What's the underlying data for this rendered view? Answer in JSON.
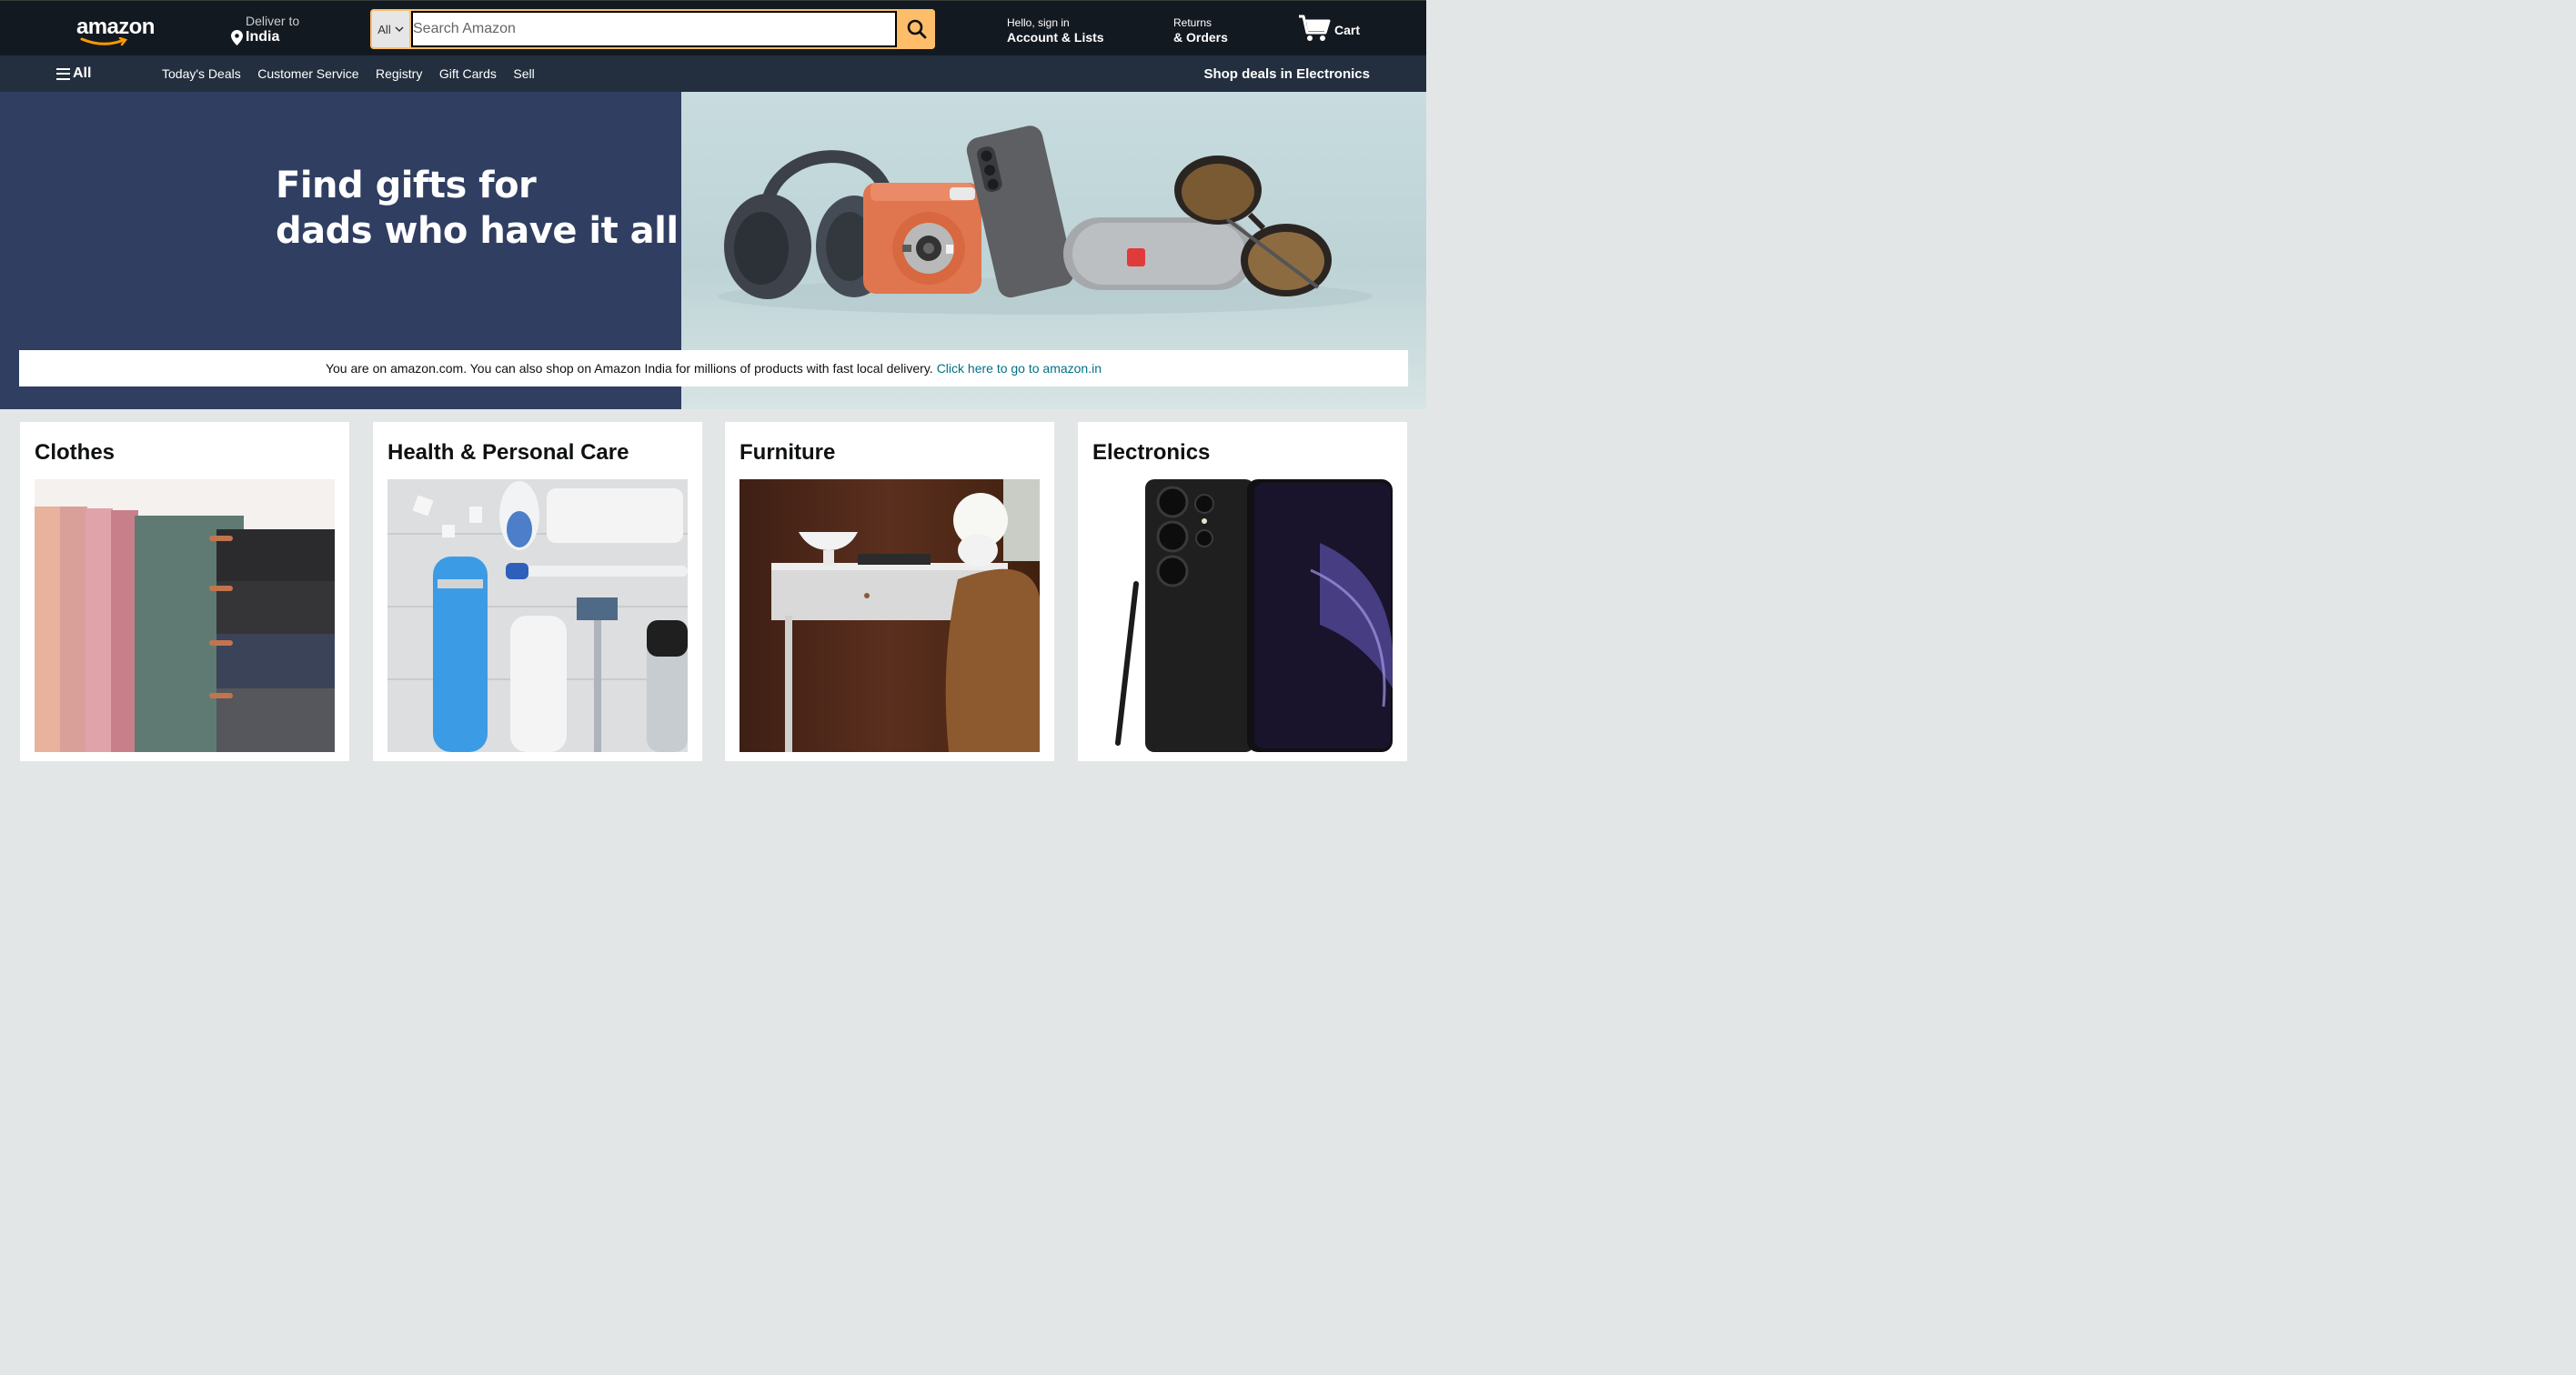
{
  "header": {
    "logo_text": "amazon",
    "deliver_label": "Deliver to",
    "deliver_location": "India",
    "search_department": "All",
    "search_placeholder": "Search Amazon",
    "account_greeting": "Hello, sign in",
    "account_label": "Account & Lists",
    "returns_label": "Returns",
    "orders_label": "& Orders",
    "cart_label": "Cart",
    "accent_color": "#febd69"
  },
  "subnav": {
    "all_label": "All",
    "links": [
      "Today's Deals",
      "Customer Service",
      "Registry",
      "Gift Cards",
      "Sell"
    ],
    "promo": "Shop deals in Electronics"
  },
  "hero": {
    "title_line1": "Find gifts for",
    "title_line2": "dads who have it all",
    "notice_text": "You are on amazon.com. You can also shop on Amazon India for millions of products with fast local delivery.",
    "notice_link": "Click here to go to amazon.in"
  },
  "cards": [
    {
      "title": "Clothes"
    },
    {
      "title": "Health & Personal Care"
    },
    {
      "title": "Furniture"
    },
    {
      "title": "Electronics"
    }
  ]
}
